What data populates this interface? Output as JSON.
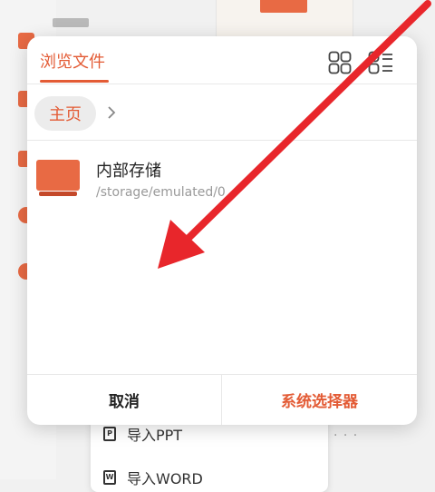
{
  "colors": {
    "accent": "#e35b35",
    "arrow": "#e8262b"
  },
  "background": {
    "menu_items": [
      {
        "label": "导入PPT",
        "icon": "ppt-file-icon",
        "glyph": "P"
      },
      {
        "label": "导入WORD",
        "icon": "word-file-icon",
        "glyph": "W"
      }
    ]
  },
  "dialog": {
    "tab_label": "浏览文件",
    "icons": [
      "grid-view-icon",
      "list-view-icon"
    ],
    "breadcrumb": {
      "home_label": "主页",
      "icon": "chevron-right-icon"
    },
    "storage": {
      "name": "内部存储",
      "path": "/storage/emulated/0",
      "icon": "storage-folder-icon"
    },
    "footer": {
      "cancel_label": "取消",
      "system_picker_label": "系统选择器"
    }
  },
  "overlay": {
    "icon": "red-arrow-annotation"
  }
}
